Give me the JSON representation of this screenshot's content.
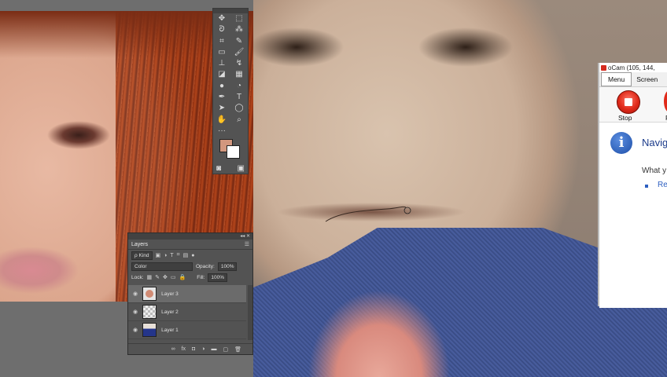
{
  "photoshop": {
    "tools": [
      {
        "icon": "move-icon",
        "glyph": "✥"
      },
      {
        "icon": "marquee-icon",
        "glyph": "⬚"
      },
      {
        "icon": "lasso-icon",
        "glyph": "ᘐ"
      },
      {
        "icon": "magic-wand-icon",
        "glyph": "⁂"
      },
      {
        "icon": "crop-icon",
        "glyph": "⌗"
      },
      {
        "icon": "eyedropper-icon",
        "glyph": "✎"
      },
      {
        "icon": "healing-icon",
        "glyph": "▭"
      },
      {
        "icon": "brush-icon",
        "glyph": "🖌"
      },
      {
        "icon": "stamp-icon",
        "glyph": "⊥"
      },
      {
        "icon": "history-brush-icon",
        "glyph": "↯"
      },
      {
        "icon": "eraser-icon",
        "glyph": "◪"
      },
      {
        "icon": "gradient-icon",
        "glyph": "▦"
      },
      {
        "icon": "blur-icon",
        "glyph": "●"
      },
      {
        "icon": "dodge-icon",
        "glyph": "◔"
      },
      {
        "icon": "pen-icon",
        "glyph": "✒"
      },
      {
        "icon": "type-icon",
        "glyph": "T"
      },
      {
        "icon": "path-select-icon",
        "glyph": "➤"
      },
      {
        "icon": "shape-icon",
        "glyph": "◯"
      },
      {
        "icon": "hand-icon",
        "glyph": "✋"
      },
      {
        "icon": "zoom-icon",
        "glyph": "⌕"
      },
      {
        "icon": "more-icon",
        "glyph": "···"
      },
      {
        "icon": "edit-toolbar-icon",
        "glyph": ""
      }
    ],
    "colors": {
      "foreground": "#d2977e",
      "background": "#ffffff"
    },
    "layers_panel": {
      "tab": "Layers",
      "kind": "ρ Kind",
      "blend_mode": "Color",
      "opacity_label": "Opacity:",
      "opacity_value": "100%",
      "lock_label": "Lock:",
      "fill_label": "Fill:",
      "fill_value": "100%",
      "layers": [
        {
          "name": "Layer 3",
          "active": true
        },
        {
          "name": "Layer 2",
          "active": false
        },
        {
          "name": "Layer 1",
          "active": false
        }
      ]
    }
  },
  "ocam": {
    "title": "oCam (105, 144,",
    "menu": "Menu",
    "screen": "Screen",
    "stop": "Stop",
    "second_button": "P",
    "navigate": "Navig",
    "what": "What y",
    "link": "Re"
  }
}
